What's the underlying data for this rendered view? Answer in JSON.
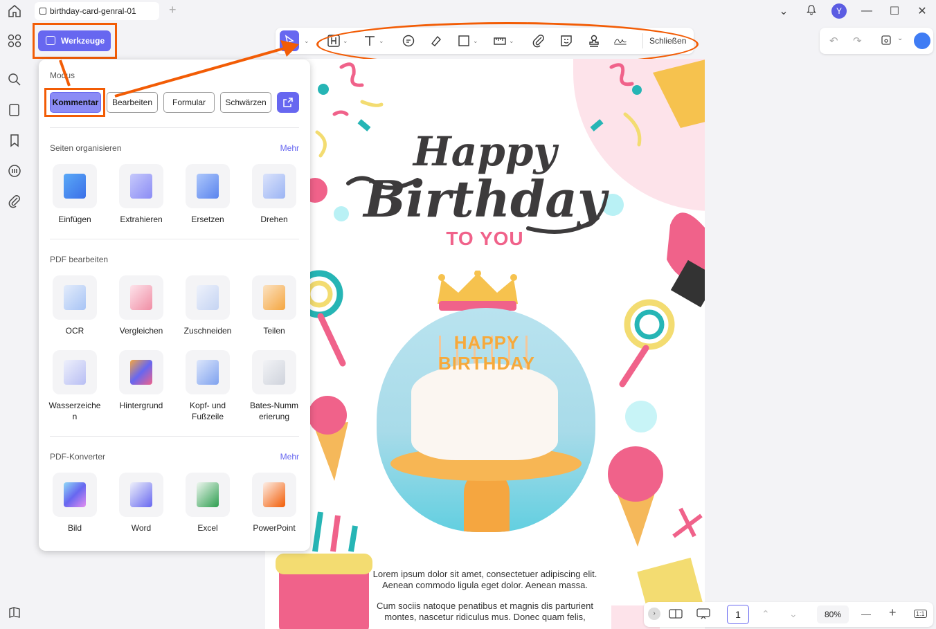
{
  "titlebar": {
    "tab_title": "birthday-card-genral-01",
    "tab_add": "+",
    "avatar_initial": "Y"
  },
  "werkzeuge_label": "Werkzeuge",
  "toolbar": {
    "close_label": "Schließen"
  },
  "panel": {
    "mode_heading": "Modus",
    "modes": [
      "Kommentar",
      "Bearbeiten",
      "Formular",
      "Schwärzen"
    ],
    "section_organize": "Seiten organisieren",
    "section_edit": "PDF bearbeiten",
    "section_convert": "PDF-Konverter",
    "more_label": "Mehr",
    "organize_items": [
      "Einfügen",
      "Extrahieren",
      "Ersetzen",
      "Drehen"
    ],
    "edit_items_row1": [
      "OCR",
      "Vergleichen",
      "Zuschneiden",
      "Teilen"
    ],
    "edit_items_row2": [
      "Wasserzeichen",
      "Hintergrund",
      "Kopf- und Fußzeile",
      "Bates-Nummerierung"
    ],
    "edit_items_row2_display": [
      [
        "Wasserzeiche",
        "n"
      ],
      [
        "Hintergrund",
        ""
      ],
      [
        "Kopf- und",
        "Fußzeile"
      ],
      [
        "Bates-Numm",
        "erierung"
      ]
    ],
    "convert_items": [
      "Bild",
      "Word",
      "Excel",
      "PowerPoint"
    ]
  },
  "document": {
    "line1": "Happy",
    "line2": "Birthday",
    "line3": "TO YOU",
    "cake_letters": "HAPPY BIRTHDAY",
    "lorem1_a": "Lorem ipsum dolor sit amet, consectetuer adipiscing elit.",
    "lorem1_b": "Aenean commodo ligula eget dolor. Aenean massa.",
    "lorem2_a": "Cum sociis natoque penatibus et magnis dis parturient",
    "lorem2_b": "montes, nascetur ridiculus mus. Donec quam felis,"
  },
  "statusbar": {
    "page_number": "1",
    "zoom": "80%",
    "fit_label": "1:1"
  },
  "colors": {
    "accent": "#6767f0",
    "highlight": "#f25c05",
    "pink": "#f0628a"
  }
}
